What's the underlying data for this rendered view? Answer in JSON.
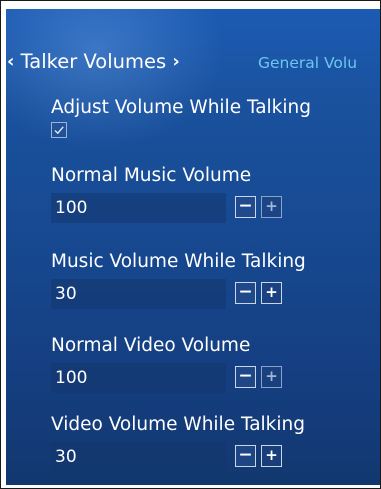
{
  "tabs": {
    "active_prev_chevron": "‹",
    "active_label": "Talker Volumes",
    "active_next_chevron": "›",
    "inactive_label": "General Volu"
  },
  "settings": {
    "adjust_volume": {
      "label": "Adjust Volume While Talking",
      "checked": true,
      "check_glyph": "✓"
    },
    "normal_music": {
      "label": "Normal Music Volume",
      "value": "100",
      "minus": "−",
      "plus": "+"
    },
    "music_talking": {
      "label": "Music Volume While Talking",
      "value": "30",
      "minus": "−",
      "plus": "+"
    },
    "normal_video": {
      "label": "Normal Video Volume",
      "value": "100",
      "minus": "−",
      "plus": "+"
    },
    "video_talking": {
      "label": "Video Volume While Talking",
      "value": "30",
      "minus": "−",
      "plus": "+"
    }
  },
  "colors": {
    "background_top": "#1c5bb3",
    "background_bottom": "#12386f",
    "active_tab_text": "#ffffff",
    "inactive_tab_text": "#6ec6ee",
    "label_text": "#ffffff"
  },
  "icons": {
    "prev": "chevron-left-icon",
    "next": "chevron-right-icon",
    "check": "checkmark-icon",
    "minus": "minus-icon",
    "plus": "plus-icon"
  }
}
